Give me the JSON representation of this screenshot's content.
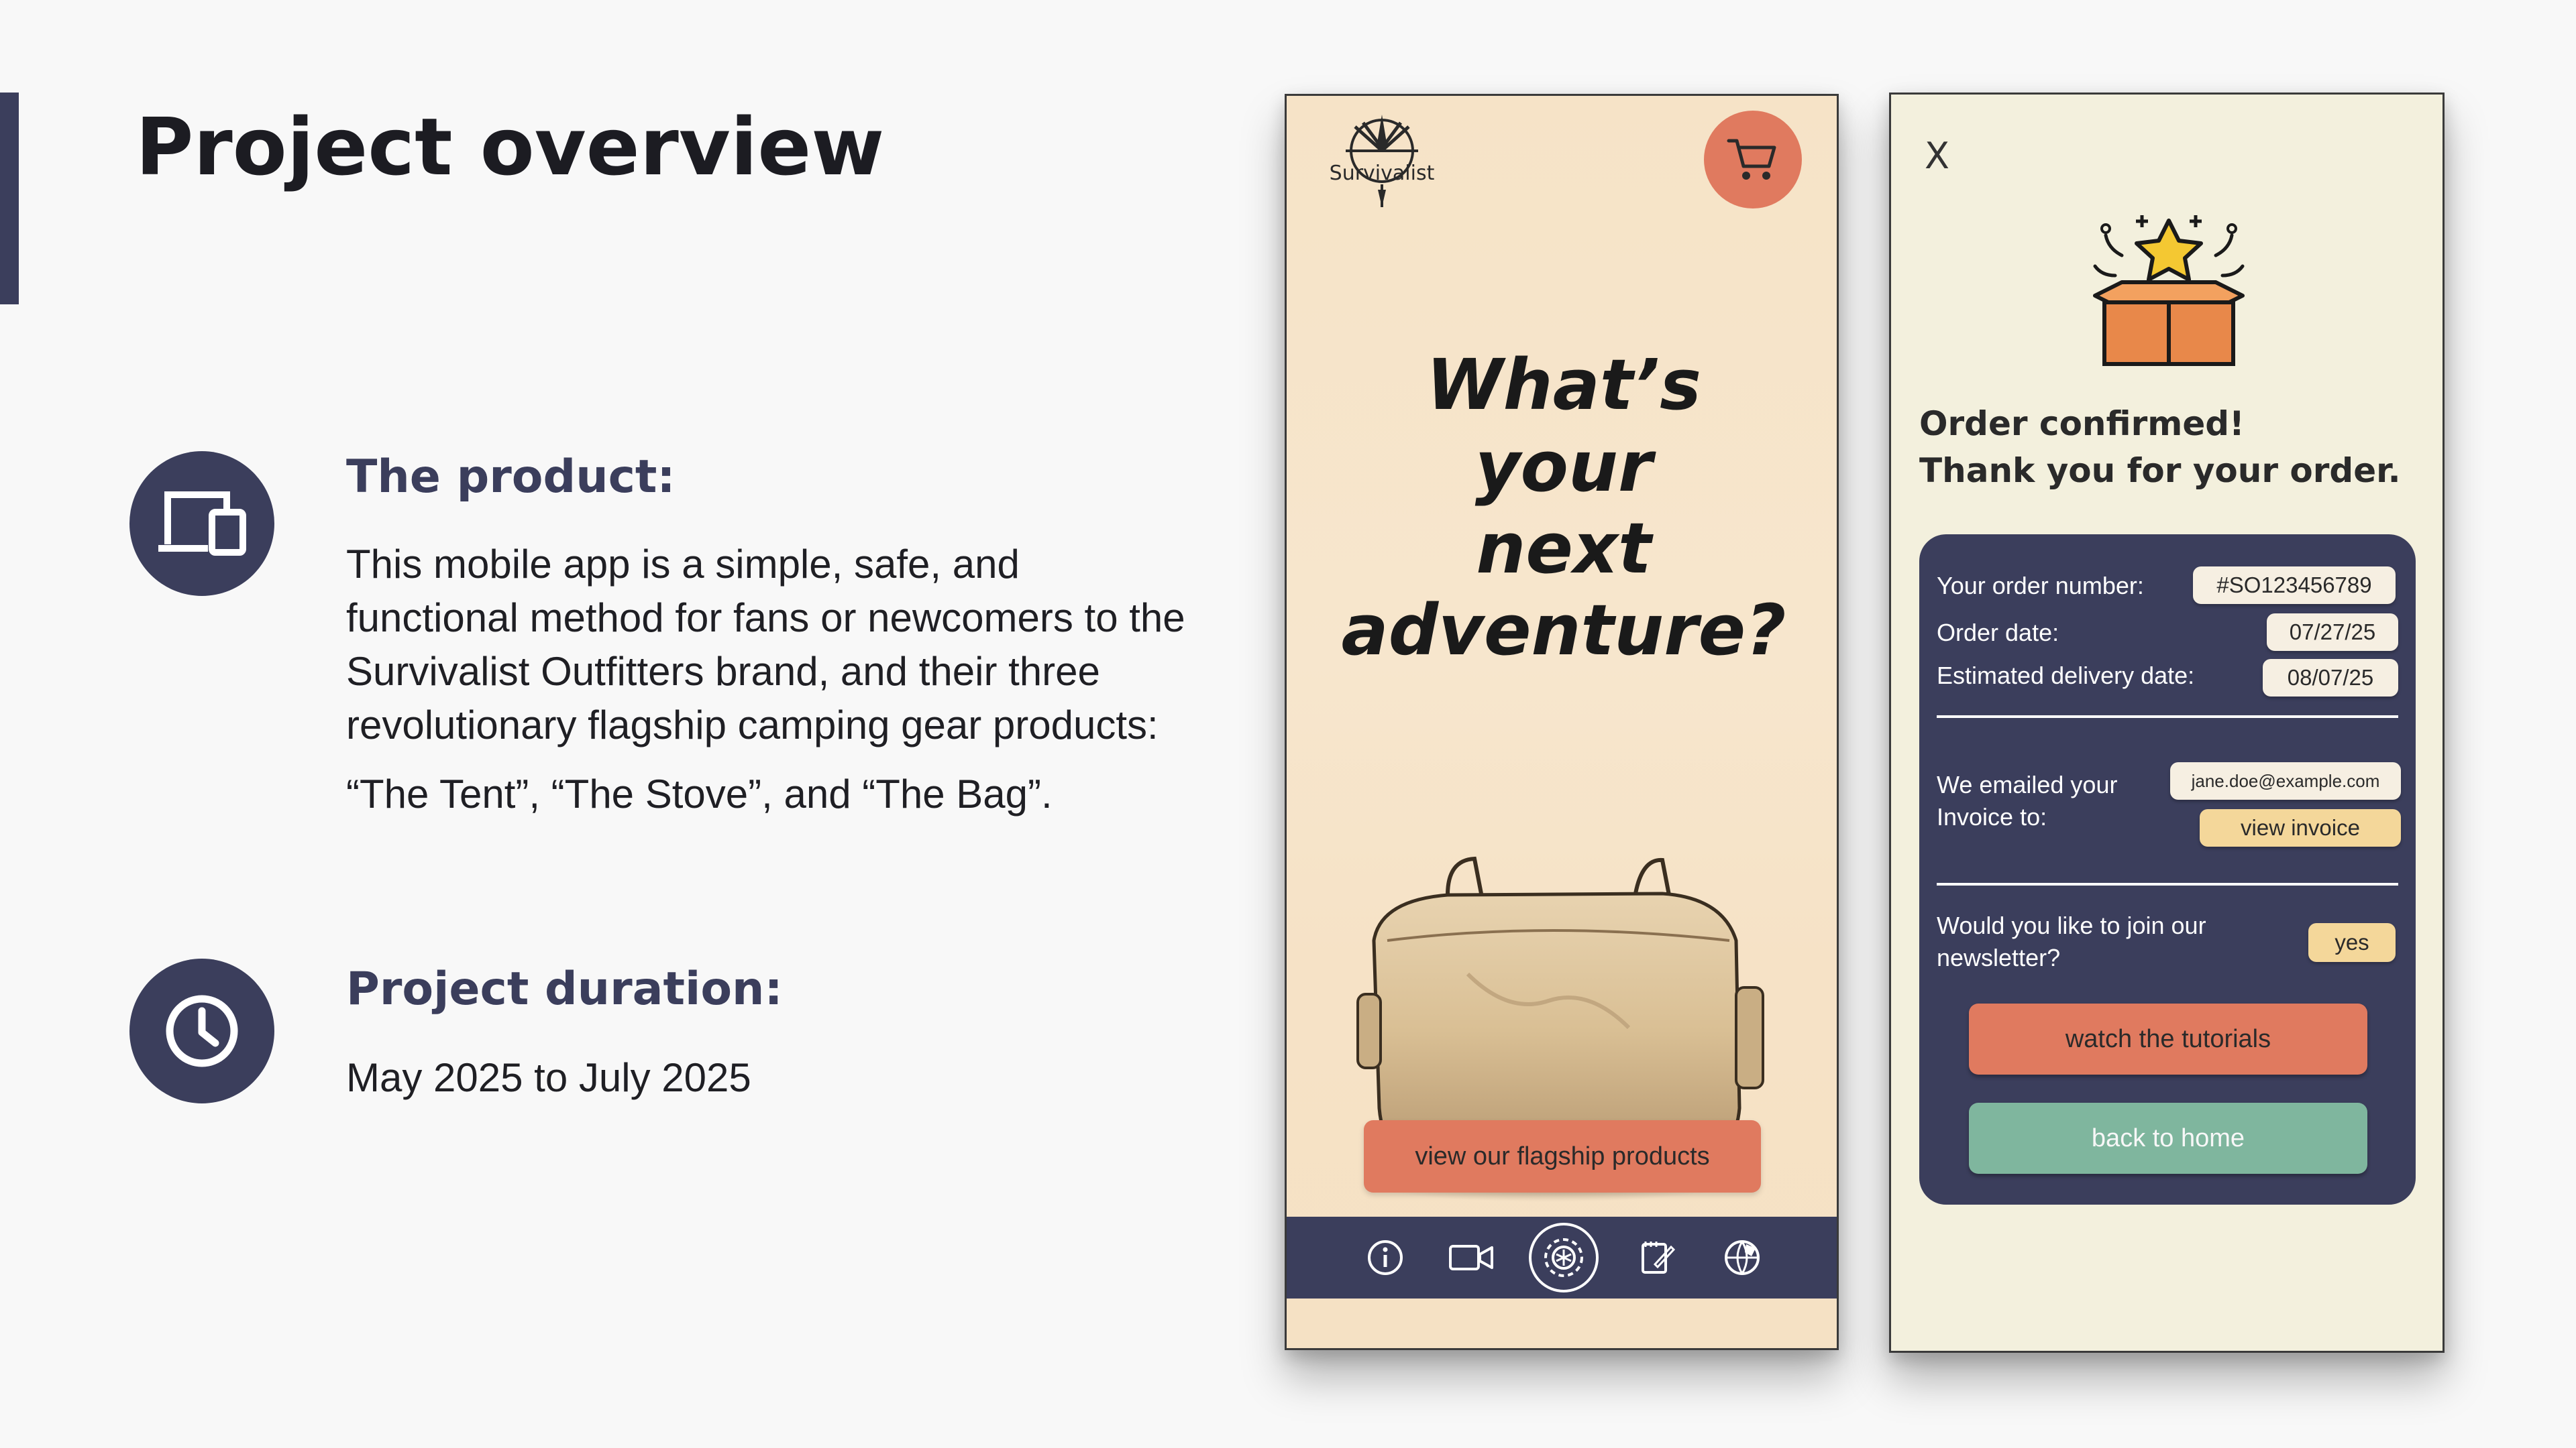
{
  "slide": {
    "title": "Project overview",
    "product": {
      "heading": "The product:",
      "description": "This mobile app is a simple, safe, and functional method for fans or newcomers to the Survivalist Outfitters brand, and their three revolutionary flagship camping gear products:",
      "products_line": "“The Tent”, “The Stove”, and “The Bag”.",
      "icon": "devices-icon"
    },
    "duration": {
      "heading": "Project duration:",
      "text": "May 2025  to July 2025",
      "icon": "clock-icon"
    }
  },
  "phone_home": {
    "logo_text": "Survivalist",
    "hero": "What’s\nyour\nnext\nadventure?",
    "cta": "view our flagship products",
    "nav_icons": [
      "info-icon",
      "video-icon",
      "gear-icon",
      "notes-icon",
      "globe-icon"
    ]
  },
  "phone_confirm": {
    "close": "X",
    "title_line1": "Order confirmed!",
    "title_line2": "Thank you for your order.",
    "order_number_label": "Your order number:",
    "order_number": "#SO123456789",
    "order_date_label": "Order date:",
    "order_date": "07/27/25",
    "delivery_label": "Estimated delivery date:",
    "delivery_date": "08/07/25",
    "emailed_label_1": "We emailed your",
    "emailed_label_2": "Invoice to:",
    "email": "jane.doe@example.com",
    "view_invoice": "view invoice",
    "newsletter_1": "Would you like to join our",
    "newsletter_2": "newsletter?",
    "newsletter_answer": "yes",
    "watch_tutorials": "watch the tutorials",
    "back_home": "back to home"
  },
  "colors": {
    "navy": "#3b3e5c",
    "coral": "#e07a5f",
    "green": "#7fb69e",
    "cream": "#f6e3c7",
    "yellow": "#f4d79a"
  }
}
